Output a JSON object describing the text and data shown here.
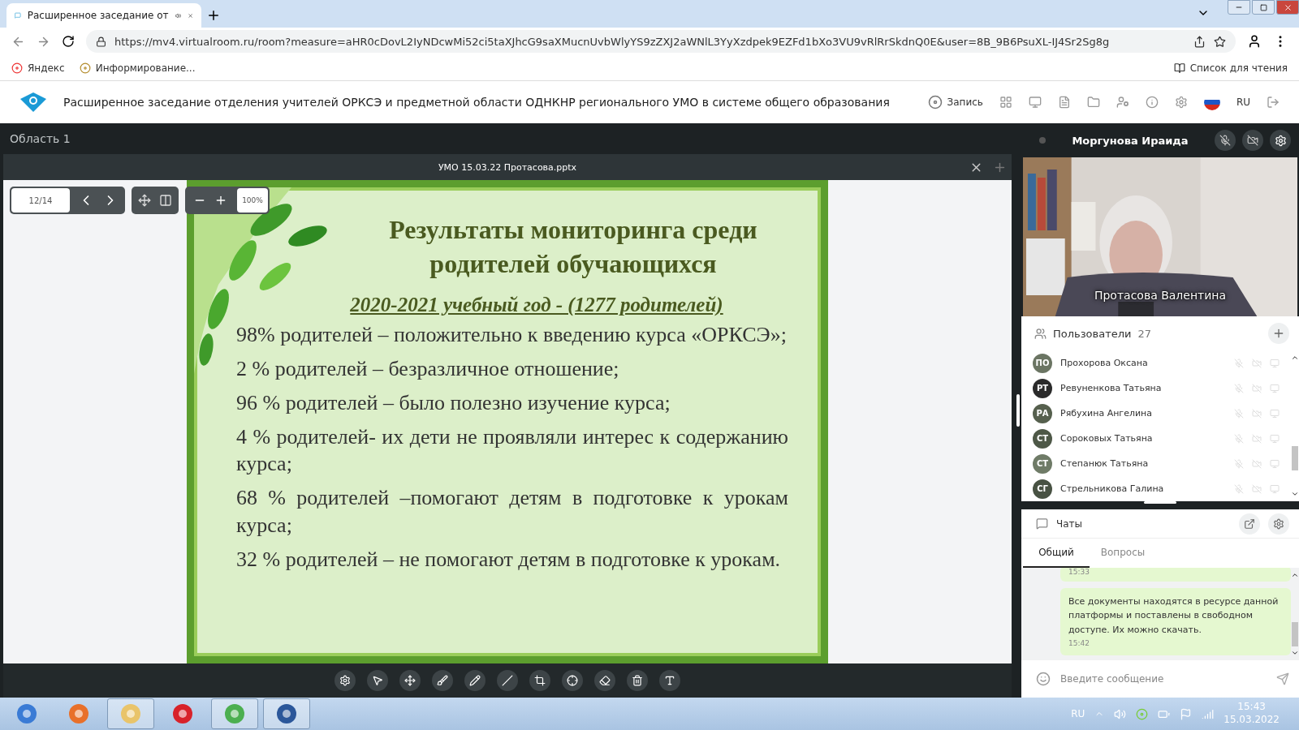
{
  "browser": {
    "tabs": [
      {
        "title": "Расширенное заседание от",
        "selected": true
      }
    ],
    "url": "https://mv4.virtualroom.ru/room?measure=aHR0cDovL2IyNDcwMi52ci5taXJhcG9saXMucnUvbWlyYS9zZXJ2aWNlL3YyXzdpek9EZFd1bXo3VU9vRlRrSkdnQ0E&user=8B_9B6PsuXL-IJ4Sr2Sg8g",
    "bookmarks": [
      "Яндекс",
      "Информирование..."
    ],
    "reading_list": "Список для чтения"
  },
  "header": {
    "title": "Расширенное заседание отделения учителей ОРКСЭ и предметной области ОДНКНР регионального УМО в системе общего образования",
    "record": "Запись",
    "language": "RU"
  },
  "area": {
    "label": "Область 1"
  },
  "document": {
    "title": "УМО 15.03.22 Протасова.pptx",
    "page": "12/14",
    "zoom": "100%"
  },
  "slide": {
    "title": "Результаты мониторинга среди родителей обучающихся",
    "subtitle": "2020-2021 учебный год -  (1277 родителей)",
    "items": [
      "98% родителей – положительно к введению курса «ОРКСЭ»;",
      "2 % родителей – безразличное отношение;",
      "96 % родителей – было полезно изучение курса;",
      "4 % родителей- их дети не проявляли интерес к содержанию курса;",
      "68 % родителей –помогают детям в подготовке к урокам курса;",
      "32  % родителей – не помогают детям в подготовке к урокам."
    ]
  },
  "video": {
    "presenter": "Моргунова Ираида",
    "caption": "Протасова Валентина"
  },
  "users": {
    "label": "Пользователи",
    "count": "27",
    "list": [
      {
        "initials": "ПО",
        "name": "Прохорова Оксана",
        "color": "#6b7563"
      },
      {
        "initials": "РТ",
        "name": "Ревуненкова Татьяна",
        "color": "#2b2b2b"
      },
      {
        "initials": "РА",
        "name": "Рябухина Ангелина",
        "color": "#56604e"
      },
      {
        "initials": "СТ",
        "name": "Сороковых Татьяна",
        "color": "#4e5847"
      },
      {
        "initials": "СТ",
        "name": "Степанюк Татьяна",
        "color": "#6f7b67"
      },
      {
        "initials": "СГ",
        "name": "Стрельникова Галина",
        "color": "#485243"
      }
    ]
  },
  "chat": {
    "title": "Чаты",
    "tabs": [
      {
        "label": "Общий",
        "selected": true
      },
      {
        "label": "Вопросы",
        "selected": false
      }
    ],
    "messages": [
      {
        "time": "15:33"
      },
      {
        "text": "Все документы находятся в ресурсе данной платформы и поставлены в свободном доступе. Их можно скачать.",
        "time": "15:42"
      }
    ],
    "placeholder": "Введите сообщение"
  },
  "taskbar": {
    "language": "RU",
    "time": "15:43",
    "date": "15.03.2022"
  }
}
